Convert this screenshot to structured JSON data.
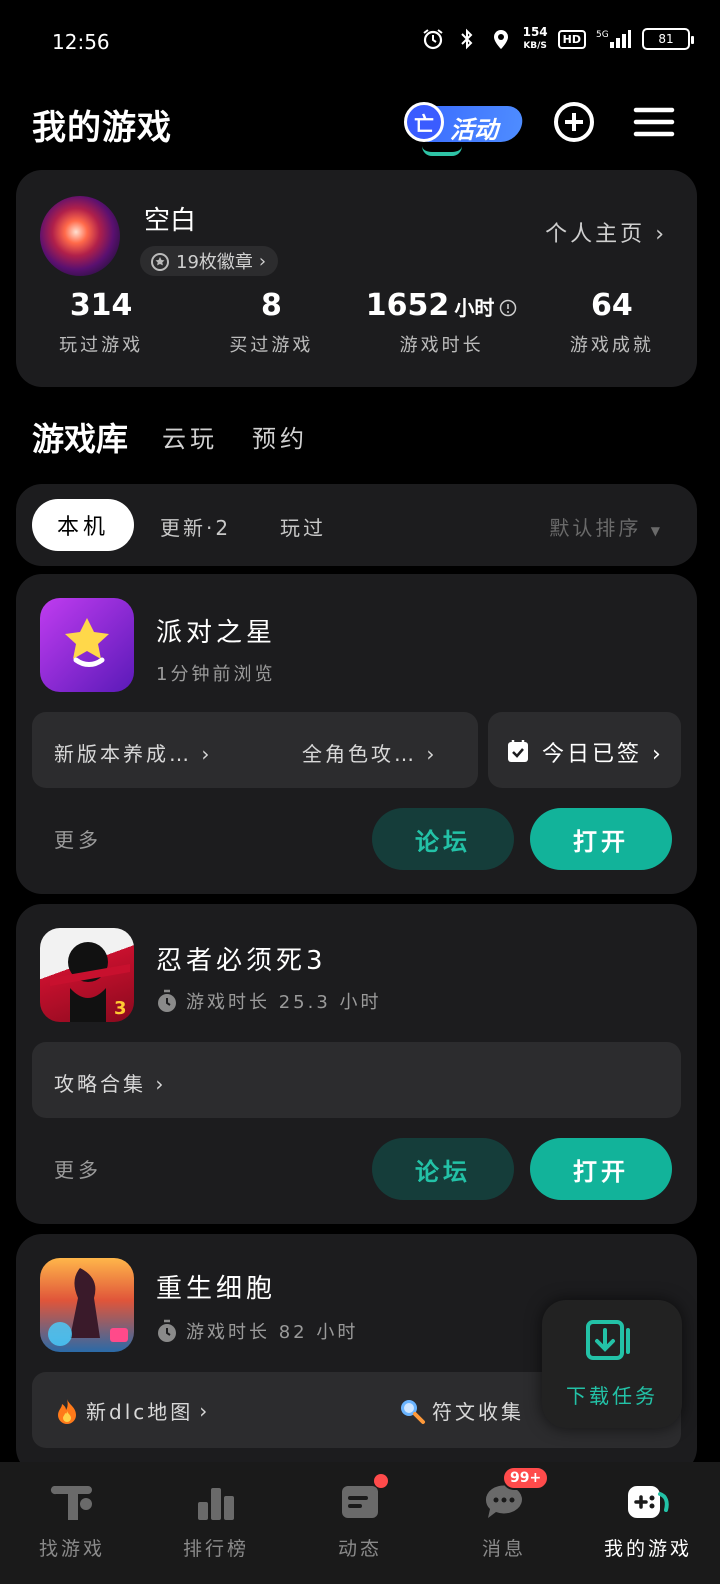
{
  "status": {
    "time": "12:56",
    "net_speed": "154",
    "net_unit": "KB/S",
    "hd": "HD",
    "battery": "81",
    "signal": "5G"
  },
  "header": {
    "title": "我的游戏",
    "activity_label": "活动",
    "activity_icon_glyph": "亡"
  },
  "profile": {
    "name": "空白",
    "badges": "19枚徽章",
    "homepage": "个人主页",
    "stats": [
      {
        "value": "314",
        "unit": "",
        "label": "玩过游戏"
      },
      {
        "value": "8",
        "unit": "",
        "label": "买过游戏"
      },
      {
        "value": "1652",
        "unit": "小时",
        "label": "游戏时长"
      },
      {
        "value": "64",
        "unit": "",
        "label": "游戏成就"
      }
    ]
  },
  "section_tabs": {
    "active": "游戏库",
    "cloud": "云玩",
    "reserve": "预约"
  },
  "filters": {
    "local": "本机",
    "updates": "更新·2",
    "played": "玩过",
    "sort": "默认排序"
  },
  "games": [
    {
      "name": "派对之星",
      "subtitle": "1分钟前浏览",
      "links": [
        "新版本养成…",
        "全角色攻…"
      ],
      "checkin": "今日已签",
      "more": "更多",
      "forum": "论坛",
      "open": "打开"
    },
    {
      "name": "忍者必须死3",
      "subtitle": "游戏时长 25.3 小时",
      "links": [
        "攻略合集"
      ],
      "more": "更多",
      "forum": "论坛",
      "open": "打开"
    },
    {
      "name": "重生细胞",
      "subtitle": "游戏时长 82 小时",
      "links": [
        "新dlc地图",
        "符文收集"
      ]
    }
  ],
  "download": {
    "label": "下载任务"
  },
  "nav": [
    {
      "label": "找游戏"
    },
    {
      "label": "排行榜"
    },
    {
      "label": "动态"
    },
    {
      "label": "消息",
      "badge": "99+"
    },
    {
      "label": "我的游戏"
    }
  ]
}
